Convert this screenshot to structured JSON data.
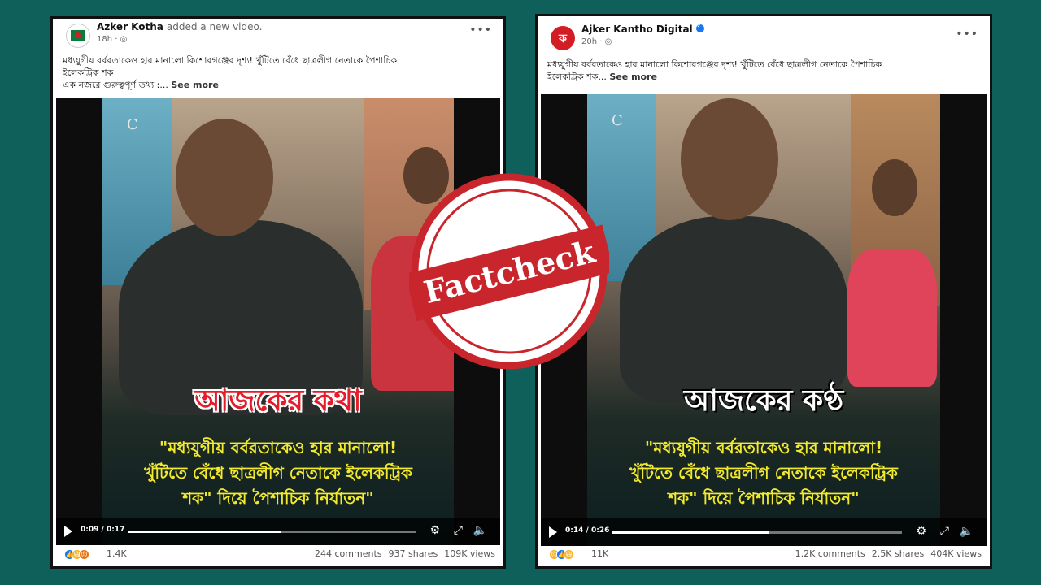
{
  "left_post": {
    "author": "Azker Kotha",
    "action": "added a new video.",
    "time": "18h · ",
    "caption_line1": "মধ্যযুগীয় বর্বরতাকেও হার মানালো কিশোরগঞ্জের দৃশ্য! খুঁটিতে বেঁধে ছাত্রলীগ নেতাকে পৈশাচিক",
    "caption_line2": "ইলেকট্রিক শক",
    "caption_line3": "এক নজরে গুরুত্বপূর্ণ তথ্য :...",
    "see_more": "See more",
    "video": {
      "banner": "আজকের কথা",
      "headline_line1": "\"মধ্যযুগীয় বর্বরতাকেও হার মানালো!",
      "headline_line2": "খুঁটিতে বেঁধে ছাত্রলীগ নেতাকে ইলেকট্রিক",
      "headline_line3": "শক\" দিয়ে পৈশাচিক নির্যাতন\"",
      "time": "0:09 / 0:17",
      "progress": 0.53
    },
    "reaction_count": "1.4K",
    "comments": "244 comments",
    "shares": "937 shares",
    "views": "109K views"
  },
  "right_post": {
    "author": "Ajker Kantho Digital",
    "time": "20h · ",
    "caption_line1": "মধ্যযুগীয় বর্বরতাকেও হার মানালো কিশোরগঞ্জের দৃশ্য! খুঁটিতে বেঁধে ছাত্রলীগ নেতাকে পৈশাচিক",
    "caption_line2": "ইলেকট্রিক শক...",
    "see_more": "See more",
    "video": {
      "banner": "আজকের কণ্ঠ",
      "headline_line1": "\"মধ্যযুগীয় বর্বরতাকেও হার মানালো!",
      "headline_line2": "খুঁটিতে বেঁধে ছাত্রলীগ নেতাকে ইলেকট্রিক",
      "headline_line3": "শক\" দিয়ে পৈশাচিক নির্যাতন\"",
      "time": "0:14 / 0:26",
      "progress": 0.54
    },
    "reaction_count": "11K",
    "comments": "1.2K comments",
    "shares": "2.5K shares",
    "views": "404K views"
  },
  "stamp": {
    "label": "Factcheck",
    "color": "#c8262c"
  },
  "colors": {
    "background": "#0f5f5a",
    "headline": "#f2ea2e",
    "left_banner": "#e51d2a"
  }
}
